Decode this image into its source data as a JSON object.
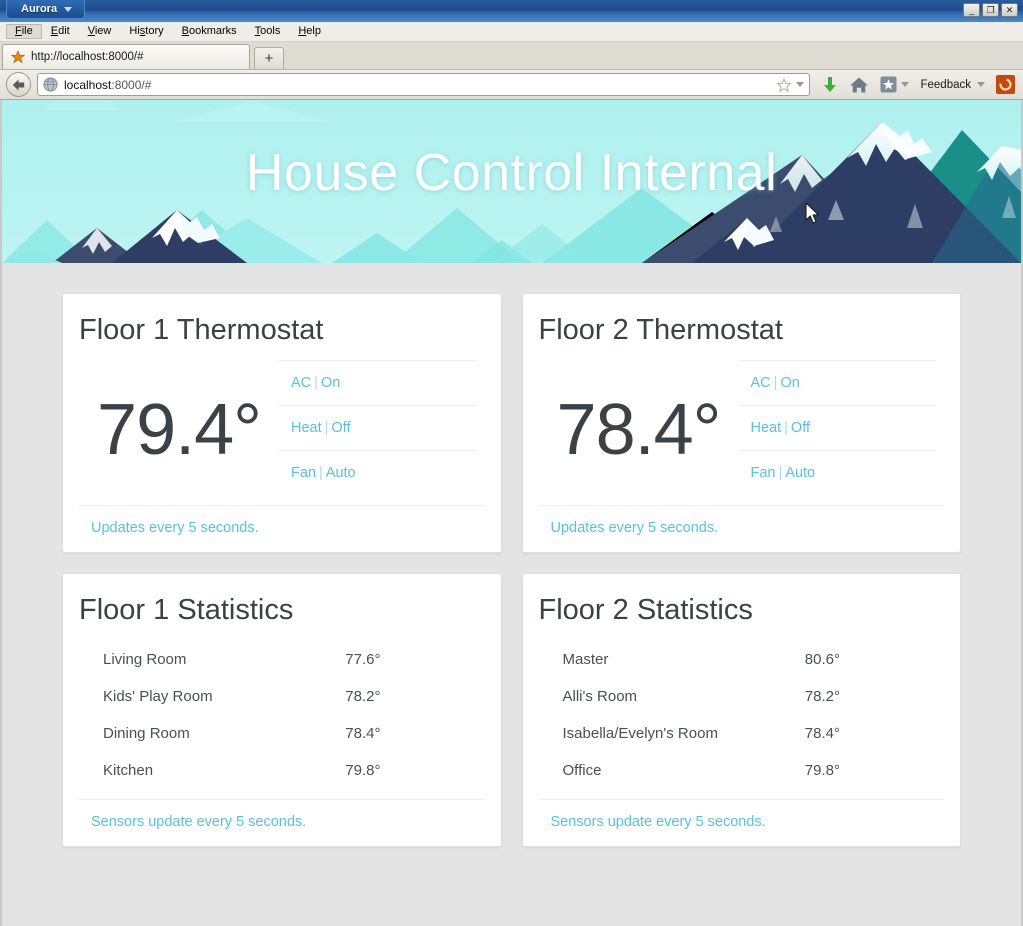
{
  "browser": {
    "app_button": "Aurora",
    "window_buttons": [
      {
        "name": "minimize",
        "glyph": "_"
      },
      {
        "name": "maximize",
        "glyph": "❐"
      },
      {
        "name": "close",
        "glyph": "✕"
      }
    ],
    "menus": [
      {
        "label": "File",
        "access_key": "F"
      },
      {
        "label": "Edit",
        "access_key": "E"
      },
      {
        "label": "View",
        "access_key": "V"
      },
      {
        "label": "History",
        "access_key": "s"
      },
      {
        "label": "Bookmarks",
        "access_key": "B"
      },
      {
        "label": "Tools",
        "access_key": "T"
      },
      {
        "label": "Help",
        "access_key": "H"
      }
    ],
    "tab": {
      "title": "http://localhost:8000/#",
      "favicon": "star-icon"
    },
    "new_tab_label": "+",
    "address": {
      "host": "localhost",
      "path": ":8000/#",
      "full": "localhost:8000/#"
    },
    "toolbar": {
      "download_icon": "download-arrow-icon",
      "home_icon": "home-icon",
      "bookmark_icon": "bookmark-star-icon",
      "feedback_label": "Feedback",
      "extension_icon": "extension-icon"
    }
  },
  "page": {
    "hero_title": "House Control Internal",
    "colors": {
      "link": "#5bc0de",
      "heading": "#3c4146",
      "page_bg": "#e4e4e4",
      "card_bg": "#ffffff",
      "sky": "#b3f1ef",
      "mountain_dark": "#2d3d63",
      "mountain_teal": "#1f9e94",
      "mountain_pale": "#8aeae6"
    },
    "thermostats": [
      {
        "title": "Floor 1 Thermostat",
        "temperature": "79.4°",
        "modes": [
          {
            "name": "AC",
            "value": "On"
          },
          {
            "name": "Heat",
            "value": "Off"
          },
          {
            "name": "Fan",
            "value": "Auto"
          }
        ],
        "footer": "Updates every 5 seconds."
      },
      {
        "title": "Floor 2 Thermostat",
        "temperature": "78.4°",
        "modes": [
          {
            "name": "AC",
            "value": "On"
          },
          {
            "name": "Heat",
            "value": "Off"
          },
          {
            "name": "Fan",
            "value": "Auto"
          }
        ],
        "footer": "Updates every 5 seconds."
      }
    ],
    "statistics": [
      {
        "title": "Floor 1 Statistics",
        "rooms": [
          {
            "name": "Living Room",
            "temperature": "77.6°"
          },
          {
            "name": "Kids' Play Room",
            "temperature": "78.2°"
          },
          {
            "name": "Dining Room",
            "temperature": "78.4°"
          },
          {
            "name": "Kitchen",
            "temperature": "79.8°"
          }
        ],
        "footer": "Sensors update every 5 seconds."
      },
      {
        "title": "Floor 2 Statistics",
        "rooms": [
          {
            "name": "Master",
            "temperature": "80.6°"
          },
          {
            "name": "Alli's Room",
            "temperature": "78.2°"
          },
          {
            "name": "Isabella/Evelyn's Room",
            "temperature": "78.4°"
          },
          {
            "name": "Office",
            "temperature": "79.8°"
          }
        ],
        "footer": "Sensors update every 5 seconds."
      }
    ]
  }
}
